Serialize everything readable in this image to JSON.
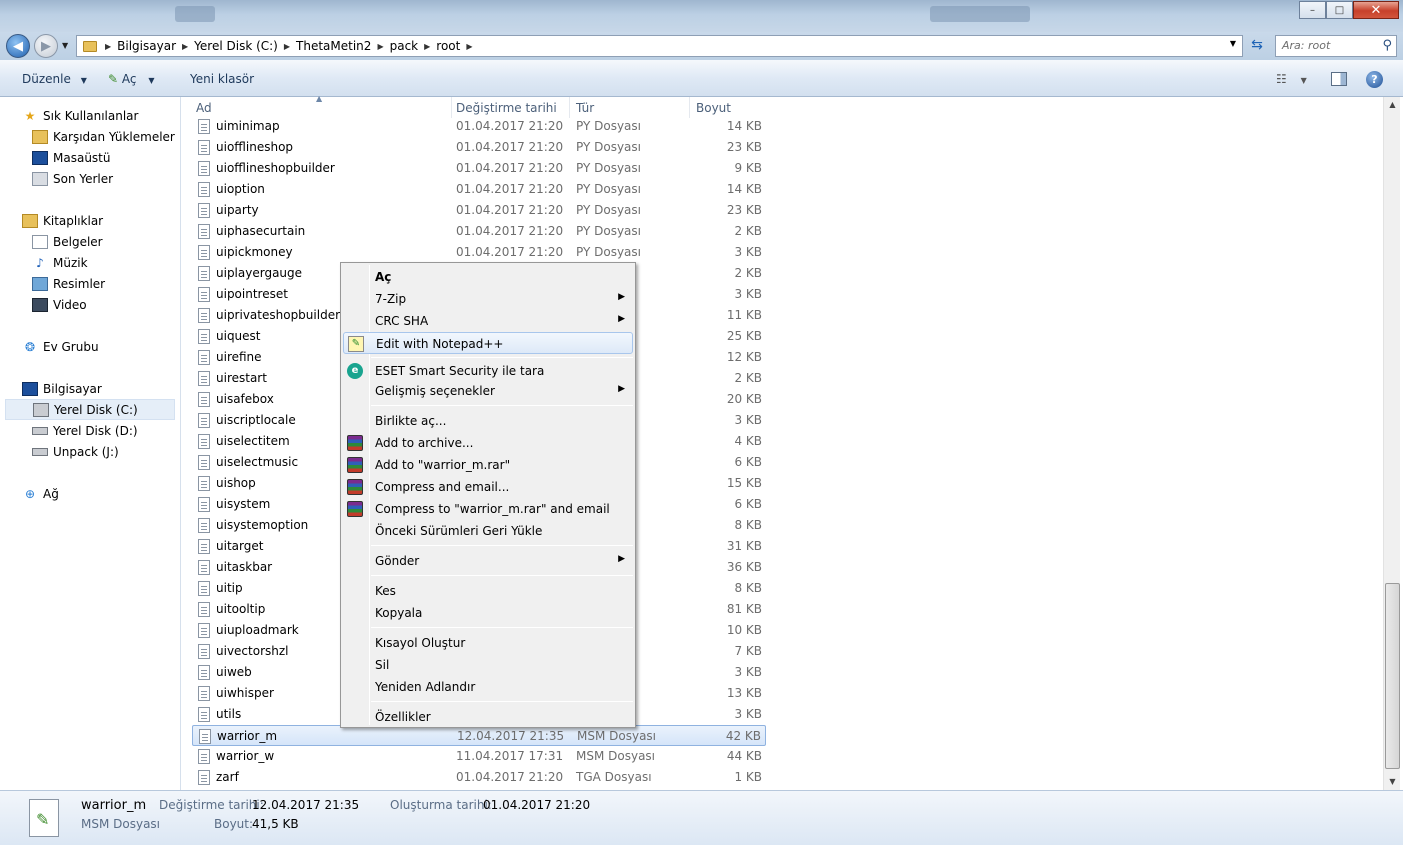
{
  "window": {
    "minimize_label": "–",
    "maximize_label": "□",
    "close_label": "✕"
  },
  "address": {
    "segments": [
      "Bilgisayar",
      "Yerel Disk (C:)",
      "ThetaMetin2",
      "pack",
      "root"
    ],
    "search_placeholder": "Ara: root"
  },
  "toolbar": {
    "organize_label": "Düzenle",
    "open_label": "Aç",
    "new_folder_label": "Yeni klasör"
  },
  "sidebar": {
    "favorites": "Sık Kullanılanlar",
    "downloads": "Karşıdan Yüklemeler",
    "desktop": "Masaüstü",
    "recent": "Son Yerler",
    "libraries": "Kitaplıklar",
    "documents": "Belgeler",
    "music": "Müzik",
    "pictures": "Resimler",
    "videos": "Video",
    "homegroup": "Ev Grubu",
    "computer": "Bilgisayar",
    "drive_c": "Yerel Disk (C:)",
    "drive_d": "Yerel Disk (D:)",
    "drive_j": "Unpack (J:)",
    "network": "Ağ"
  },
  "columns": {
    "name": "Ad",
    "date": "Değiştirme tarihi",
    "type": "Tür",
    "size": "Boyut"
  },
  "files": [
    {
      "name": "uiminimap",
      "date": "01.04.2017 21:20",
      "type": "PY Dosyası",
      "size": "14 KB"
    },
    {
      "name": "uiofflineshop",
      "date": "01.04.2017 21:20",
      "type": "PY Dosyası",
      "size": "23 KB"
    },
    {
      "name": "uiofflineshopbuilder",
      "date": "01.04.2017 21:20",
      "type": "PY Dosyası",
      "size": "9 KB"
    },
    {
      "name": "uioption",
      "date": "01.04.2017 21:20",
      "type": "PY Dosyası",
      "size": "14 KB"
    },
    {
      "name": "uiparty",
      "date": "01.04.2017 21:20",
      "type": "PY Dosyası",
      "size": "23 KB"
    },
    {
      "name": "uiphasecurtain",
      "date": "01.04.2017 21:20",
      "type": "PY Dosyası",
      "size": "2 KB"
    },
    {
      "name": "uipickmoney",
      "date": "01.04.2017 21:20",
      "type": "PY Dosyası",
      "size": "3 KB"
    },
    {
      "name": "uiplayergauge",
      "date": "",
      "type": "",
      "size": "2 KB"
    },
    {
      "name": "uipointreset",
      "date": "",
      "type": "",
      "size": "3 KB"
    },
    {
      "name": "uiprivateshopbuilder",
      "date": "",
      "type": "",
      "size": "11 KB"
    },
    {
      "name": "uiquest",
      "date": "",
      "type": "",
      "size": "25 KB"
    },
    {
      "name": "uirefine",
      "date": "",
      "type": "",
      "size": "12 KB"
    },
    {
      "name": "uirestart",
      "date": "",
      "type": "",
      "size": "2 KB"
    },
    {
      "name": "uisafebox",
      "date": "",
      "type": "",
      "size": "20 KB"
    },
    {
      "name": "uiscriptlocale",
      "date": "",
      "type": "",
      "size": "3 KB"
    },
    {
      "name": "uiselectitem",
      "date": "",
      "type": "",
      "size": "4 KB"
    },
    {
      "name": "uiselectmusic",
      "date": "",
      "type": "",
      "size": "6 KB"
    },
    {
      "name": "uishop",
      "date": "",
      "type": "",
      "size": "15 KB"
    },
    {
      "name": "uisystem",
      "date": "",
      "type": "",
      "size": "6 KB"
    },
    {
      "name": "uisystemoption",
      "date": "",
      "type": "",
      "size": "8 KB"
    },
    {
      "name": "uitarget",
      "date": "",
      "type": "",
      "size": "31 KB"
    },
    {
      "name": "uitaskbar",
      "date": "",
      "type": "",
      "size": "36 KB"
    },
    {
      "name": "uitip",
      "date": "",
      "type": "",
      "size": "8 KB"
    },
    {
      "name": "uitooltip",
      "date": "",
      "type": "",
      "size": "81 KB"
    },
    {
      "name": "uiuploadmark",
      "date": "",
      "type": "",
      "size": "10 KB"
    },
    {
      "name": "uivectorshzl",
      "date": "",
      "type": "",
      "size": "7 KB"
    },
    {
      "name": "uiweb",
      "date": "",
      "type": "",
      "size": "3 KB"
    },
    {
      "name": "uiwhisper",
      "date": "",
      "type": "",
      "size": "13 KB"
    },
    {
      "name": "utils",
      "date": "",
      "type": "",
      "size": "3 KB"
    },
    {
      "name": "warrior_m",
      "date": "12.04.2017 21:35",
      "type": "MSM Dosyası",
      "size": "42 KB"
    },
    {
      "name": "warrior_w",
      "date": "11.04.2017 17:31",
      "type": "MSM Dosyası",
      "size": "44 KB"
    },
    {
      "name": "zarf",
      "date": "01.04.2017 21:20",
      "type": "TGA Dosyası",
      "size": "1 KB"
    }
  ],
  "context_menu": {
    "open": "Aç",
    "zip": "7-Zip",
    "crc": "CRC SHA",
    "notepad": "Edit with Notepad++",
    "eset": "ESET Smart Security ile tara",
    "advanced": "Gelişmiş seçenekler",
    "open_with": "Birlikte aç...",
    "add_archive": "Add to archive...",
    "add_rar": "Add to \"warrior_m.rar\"",
    "compress_email": "Compress and email...",
    "compress_rar_email": "Compress to \"warrior_m.rar\" and email",
    "restore": "Önceki Sürümleri Geri Yükle",
    "send_to": "Gönder",
    "cut": "Kes",
    "copy": "Kopyala",
    "shortcut": "Kısayol Oluştur",
    "delete": "Sil",
    "rename": "Yeniden Adlandır",
    "properties": "Özellikler"
  },
  "details": {
    "name": "warrior_m",
    "type": "MSM Dosyası",
    "modified_label": "Değiştirme tarihi:",
    "modified_value": "12.04.2017 21:35",
    "size_label": "Boyut:",
    "size_value": "41,5 KB",
    "created_label": "Oluşturma tarihi:",
    "created_value": "01.04.2017 21:20"
  }
}
